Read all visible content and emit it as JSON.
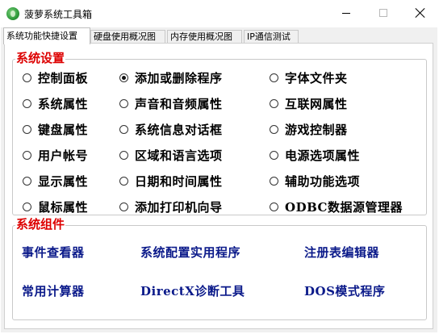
{
  "window": {
    "title": "菠萝系统工具箱"
  },
  "tabs": [
    "系统功能快捷设置",
    "硬盘使用概况图",
    "内存使用概况图",
    "IP通信测试"
  ],
  "system_settings": {
    "legend": "系统设置",
    "selected": "添加或删除程序",
    "options": [
      [
        "控制面板",
        "添加或删除程序",
        "字体文件夹"
      ],
      [
        "系统属性",
        "声音和音频属性",
        "互联网属性"
      ],
      [
        "键盘属性",
        "系统信息对话框",
        "游戏控制器"
      ],
      [
        "用户帐号",
        "区域和语言选项",
        "电源选项属性"
      ],
      [
        "显示属性",
        "日期和时间属性",
        "辅助功能选项"
      ],
      [
        "鼠标属性",
        "添加打印机向导",
        "ODBC数据源管理器"
      ]
    ]
  },
  "system_components": {
    "legend": "系统组件",
    "tools": [
      [
        "事件查看器",
        "系统配置实用程序",
        "注册表编辑器"
      ],
      [
        "常用计算器",
        "DirectX诊断工具",
        "DOS模式程序"
      ]
    ]
  },
  "colors": {
    "legend": "#dd0000",
    "tool_link": "#0b1a8a",
    "panel_bg": "#ffffff",
    "window_bg": "#f0f0f0"
  },
  "icons": {
    "app": "pineapple-app-icon",
    "minimize": "minimize-icon",
    "maximize": "maximize-icon",
    "close": "close-icon"
  }
}
